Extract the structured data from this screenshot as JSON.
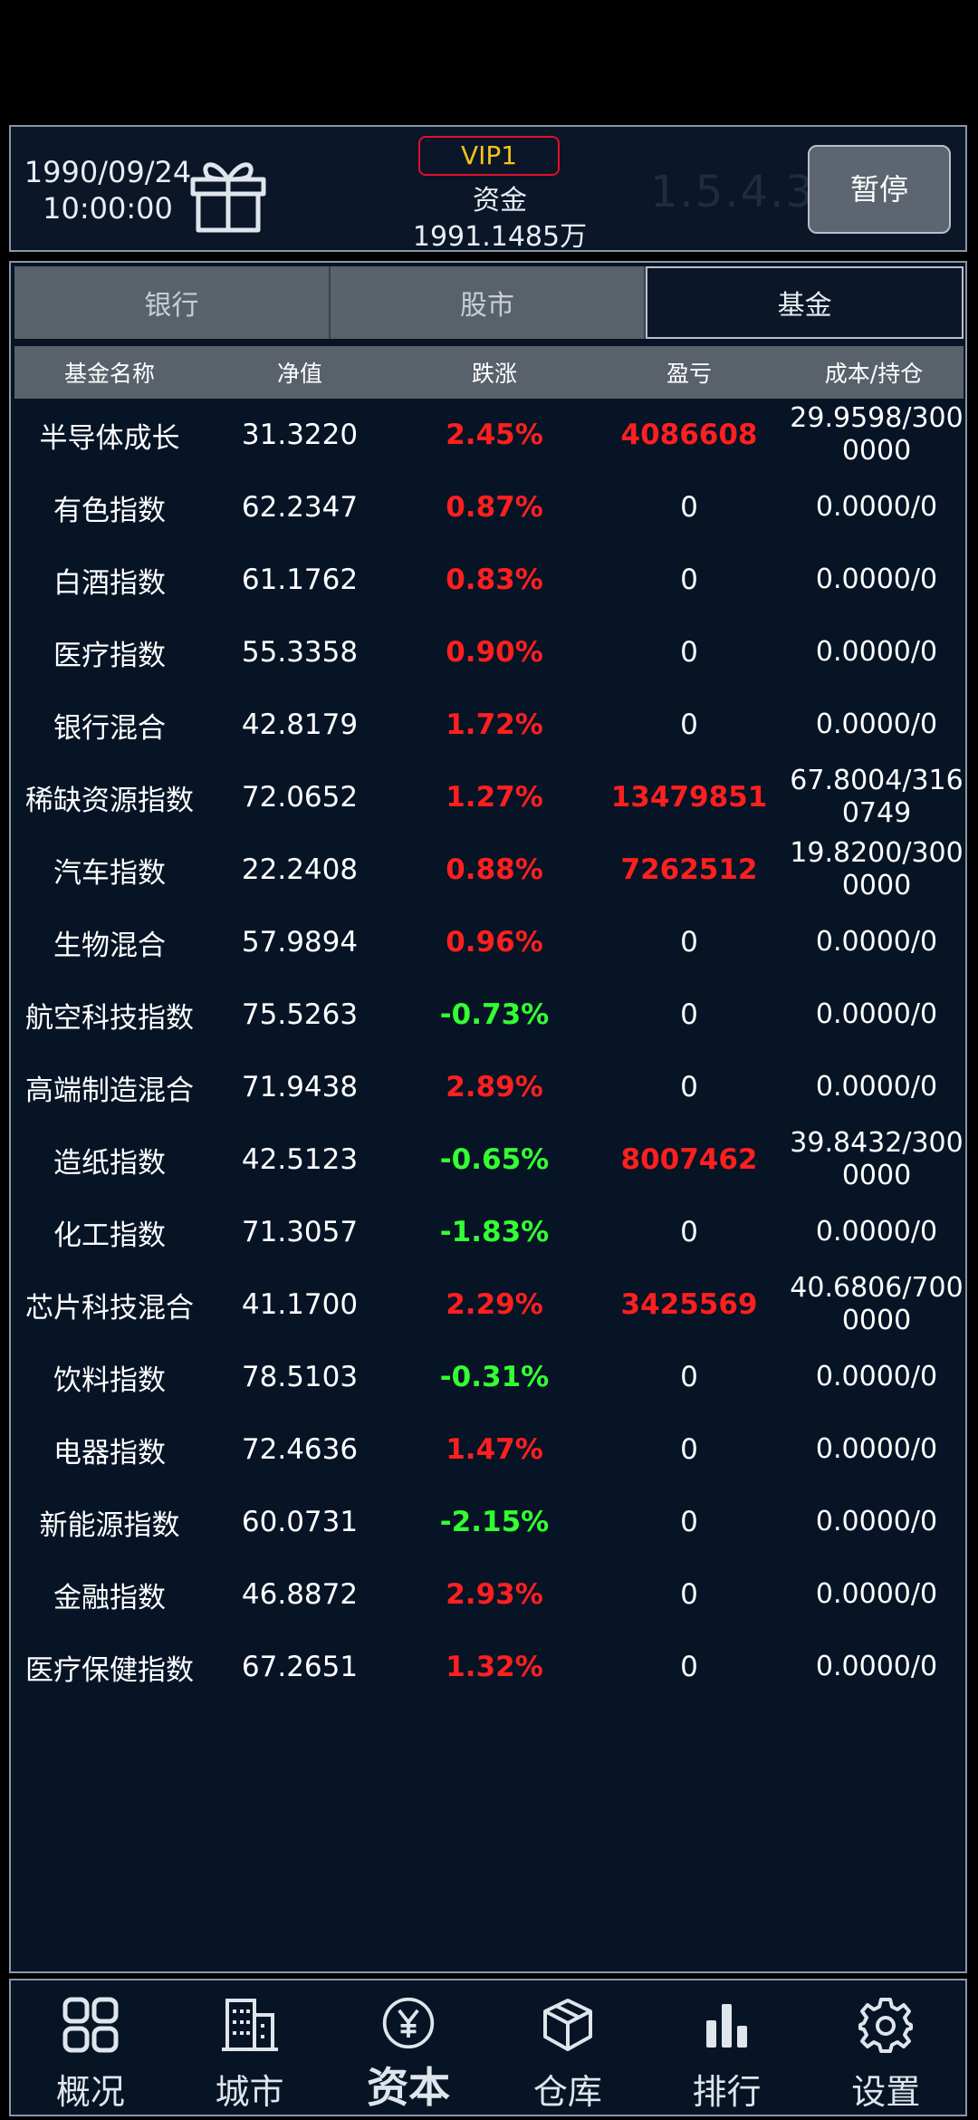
{
  "header": {
    "date": "1990/09/24",
    "time": "10:00:00",
    "vip": "VIP1",
    "funds_label": "资金",
    "funds_value": "1991.1485万",
    "version": "1.5.4.3",
    "pause_label": "暂停"
  },
  "tabs": [
    {
      "label": "银行",
      "active": false
    },
    {
      "label": "股市",
      "active": false
    },
    {
      "label": "基金",
      "active": true
    }
  ],
  "table": {
    "columns": [
      "基金名称",
      "净值",
      "跌涨",
      "盈亏",
      "成本/持仓"
    ],
    "rows": [
      {
        "name": "半导体成长",
        "nav": "31.3220",
        "change": "2.45%",
        "dir": "up",
        "pnl": "4086608",
        "cost": "29.9598/3000000"
      },
      {
        "name": "有色指数",
        "nav": "62.2347",
        "change": "0.87%",
        "dir": "up",
        "pnl": "0",
        "cost": "0.0000/0"
      },
      {
        "name": "白酒指数",
        "nav": "61.1762",
        "change": "0.83%",
        "dir": "up",
        "pnl": "0",
        "cost": "0.0000/0"
      },
      {
        "name": "医疗指数",
        "nav": "55.3358",
        "change": "0.90%",
        "dir": "up",
        "pnl": "0",
        "cost": "0.0000/0"
      },
      {
        "name": "银行混合",
        "nav": "42.8179",
        "change": "1.72%",
        "dir": "up",
        "pnl": "0",
        "cost": "0.0000/0"
      },
      {
        "name": "稀缺资源指数",
        "nav": "72.0652",
        "change": "1.27%",
        "dir": "up",
        "pnl": "13479851",
        "cost": "67.8004/3160749"
      },
      {
        "name": "汽车指数",
        "nav": "22.2408",
        "change": "0.88%",
        "dir": "up",
        "pnl": "7262512",
        "cost": "19.8200/3000000"
      },
      {
        "name": "生物混合",
        "nav": "57.9894",
        "change": "0.96%",
        "dir": "up",
        "pnl": "0",
        "cost": "0.0000/0"
      },
      {
        "name": "航空科技指数",
        "nav": "75.5263",
        "change": "-0.73%",
        "dir": "down",
        "pnl": "0",
        "cost": "0.0000/0"
      },
      {
        "name": "高端制造混合",
        "nav": "71.9438",
        "change": "2.89%",
        "dir": "up",
        "pnl": "0",
        "cost": "0.0000/0"
      },
      {
        "name": "造纸指数",
        "nav": "42.5123",
        "change": "-0.65%",
        "dir": "down",
        "pnl": "8007462",
        "cost": "39.8432/3000000"
      },
      {
        "name": "化工指数",
        "nav": "71.3057",
        "change": "-1.83%",
        "dir": "down",
        "pnl": "0",
        "cost": "0.0000/0"
      },
      {
        "name": "芯片科技混合",
        "nav": "41.1700",
        "change": "2.29%",
        "dir": "up",
        "pnl": "3425569",
        "cost": "40.6806/7000000"
      },
      {
        "name": "饮料指数",
        "nav": "78.5103",
        "change": "-0.31%",
        "dir": "down",
        "pnl": "0",
        "cost": "0.0000/0"
      },
      {
        "name": "电器指数",
        "nav": "72.4636",
        "change": "1.47%",
        "dir": "up",
        "pnl": "0",
        "cost": "0.0000/0"
      },
      {
        "name": "新能源指数",
        "nav": "60.0731",
        "change": "-2.15%",
        "dir": "down",
        "pnl": "0",
        "cost": "0.0000/0"
      },
      {
        "name": "金融指数",
        "nav": "46.8872",
        "change": "2.93%",
        "dir": "up",
        "pnl": "0",
        "cost": "0.0000/0"
      },
      {
        "name": "医疗保健指数",
        "nav": "67.2651",
        "change": "1.32%",
        "dir": "up",
        "pnl": "0",
        "cost": "0.0000/0"
      }
    ]
  },
  "nav": [
    {
      "label": "概况",
      "icon": "grid-icon",
      "active": false
    },
    {
      "label": "城市",
      "icon": "building-icon",
      "active": false
    },
    {
      "label": "资本",
      "icon": "yuan-icon",
      "active": true
    },
    {
      "label": "仓库",
      "icon": "box-icon",
      "active": false
    },
    {
      "label": "排行",
      "icon": "bar-chart-icon",
      "active": false
    },
    {
      "label": "设置",
      "icon": "gear-icon",
      "active": false
    }
  ],
  "colors": {
    "up": "#ff1f1f",
    "down": "#33ff33",
    "vip_text": "#f3c31a",
    "vip_border": "#e0102a",
    "background": "#061426"
  }
}
